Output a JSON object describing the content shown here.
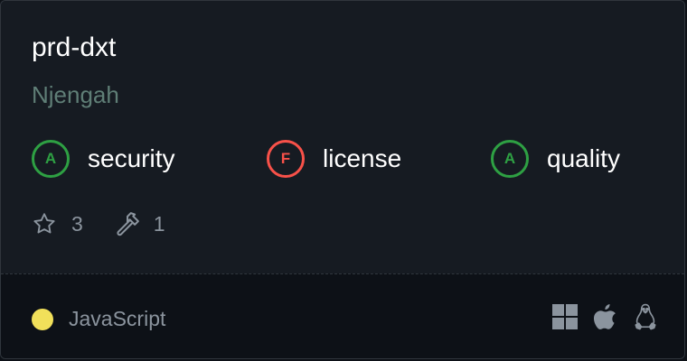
{
  "repo": {
    "name": "prd-dxt",
    "owner": "Njengah"
  },
  "scores": [
    {
      "grade": "A",
      "label": "security",
      "color": "#2ea043"
    },
    {
      "grade": "F",
      "label": "license",
      "color": "#f85149"
    },
    {
      "grade": "A",
      "label": "quality",
      "color": "#2ea043"
    }
  ],
  "stats": {
    "stars": "3",
    "tools": "1",
    "star_icon": "star-icon",
    "tools_icon": "hammer-icon"
  },
  "language": {
    "name": "JavaScript",
    "color": "#f1e05a"
  },
  "platforms": [
    "windows-icon",
    "apple-icon",
    "linux-icon"
  ]
}
